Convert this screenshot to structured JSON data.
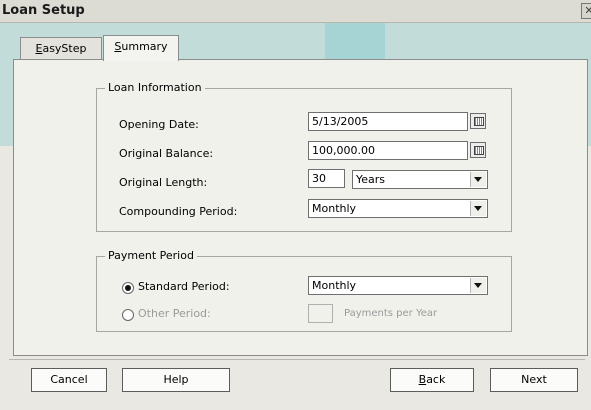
{
  "window": {
    "title": "Loan Setup",
    "close_glyph": "✕"
  },
  "tabs": [
    {
      "label_prefix": "E",
      "label_rest": "asyStep"
    },
    {
      "label_prefix": "S",
      "label_rest": "ummary"
    }
  ],
  "loan_information": {
    "legend": "Loan Information",
    "opening_date": {
      "label": "Opening Date:",
      "value": "5/13/2005"
    },
    "original_balance": {
      "label": "Original Balance:",
      "value": "100,000.00"
    },
    "original_length": {
      "label": "Original Length:",
      "value": "30",
      "unit": "Years"
    },
    "compounding_period": {
      "label": "Compounding Period:",
      "value": "Monthly"
    }
  },
  "payment_period": {
    "legend": "Payment Period",
    "standard_period": {
      "label": "Standard Period:",
      "value": "Monthly",
      "selected": true
    },
    "other_period": {
      "label": "Other Period:",
      "value": "",
      "suffix": "Payments per Year",
      "selected": false
    }
  },
  "buttons": {
    "cancel": "Cancel",
    "help": "Help",
    "back_prefix": "B",
    "back_rest": "ack",
    "next": "Next"
  }
}
